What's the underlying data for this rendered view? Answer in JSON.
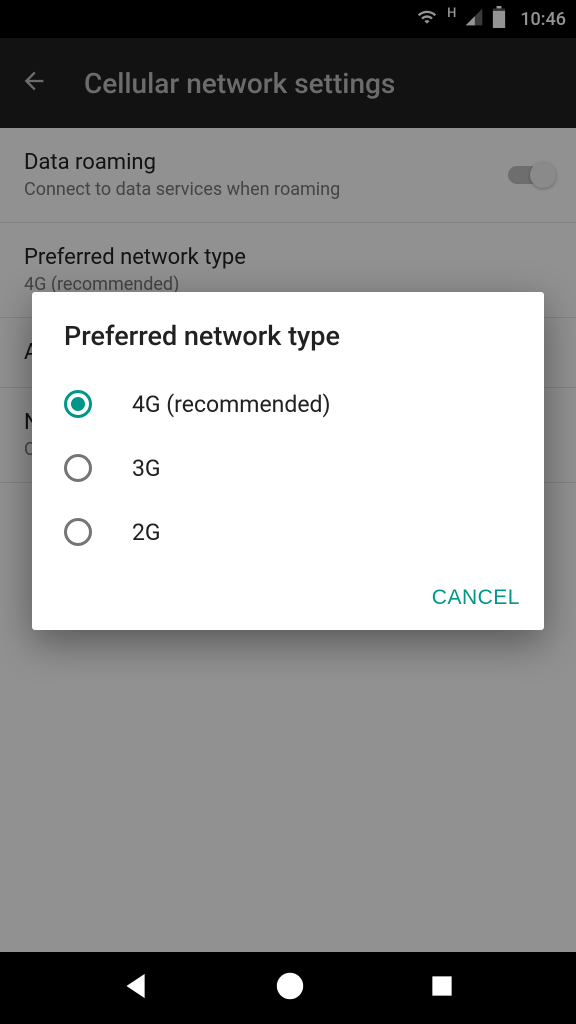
{
  "status": {
    "time": "10:46",
    "network_type": "H"
  },
  "header": {
    "title": "Cellular network settings"
  },
  "settings": {
    "data_roaming": {
      "title": "Data roaming",
      "subtitle": "Connect to data services when roaming"
    },
    "preferred_network": {
      "title": "Preferred network type",
      "subtitle": "4G (recommended)"
    },
    "access_points": {
      "title": "Access Point Names"
    },
    "network_operators": {
      "title": "Network operators",
      "subtitle": "Choose a network operator"
    }
  },
  "dialog": {
    "title": "Preferred network type",
    "options": [
      "4G (recommended)",
      "3G",
      "2G"
    ],
    "cancel": "CANCEL"
  }
}
